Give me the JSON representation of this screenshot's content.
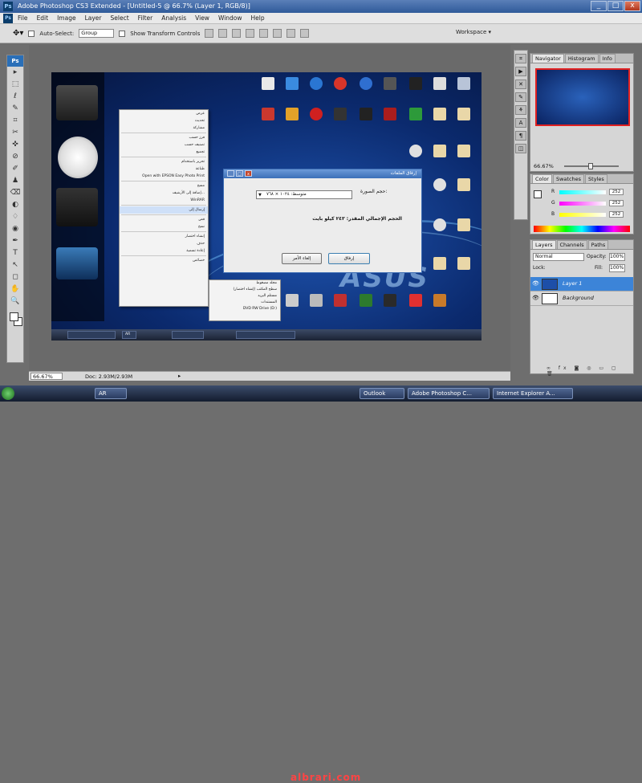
{
  "window": {
    "title": "Adobe Photoshop CS3 Extended - [Untitled-5 @ 66.7% (Layer 1, RGB/8)]",
    "app_badge": "Ps",
    "ctl_min": "_",
    "ctl_max": "□",
    "ctl_close": "x"
  },
  "menu": [
    "File",
    "Edit",
    "Image",
    "Layer",
    "Select",
    "Filter",
    "Analysis",
    "View",
    "Window",
    "Help"
  ],
  "options": {
    "tool_icon": "move-tool-icon",
    "auto_select_label": "Auto-Select:",
    "auto_select_value": "Group",
    "show_transform_label": "Show Transform Controls",
    "workspace_label": "Workspace ▾"
  },
  "toolbox": {
    "logo": "Ps",
    "tools": [
      "▸",
      "⬚",
      "ℓ",
      "✎",
      "⌗",
      "✂",
      "✜",
      "⊘",
      "✐",
      "♟",
      "⌫",
      "◐",
      "♢",
      "◉",
      "✒",
      "T",
      "↖",
      "◻",
      "✋",
      "🔍"
    ]
  },
  "canvas": {
    "brand": "ASUS",
    "ctx_menu": [
      "عرض",
      "تحديث",
      "مشاركة",
      "فرز حسب",
      "تصنيف حسب",
      "تجميع",
      "تحرير باستخدام",
      "طباعة",
      "Open with EPSON Easy Photo Print",
      "مسح",
      "إضافة إلى الأرشيف...",
      "WinRAR",
      "إرسال إلى",
      "قص",
      "نسخ",
      "إنشاء اختصار",
      "حذف",
      "إعادة تسمية",
      "خصائص"
    ],
    "submenu": [
      "مجلد مضغوط",
      "سطح المكتب (إنشاء اختصار)",
      "مستلم البريد",
      "المستندات",
      "DVD RW Drive (D:)"
    ],
    "taskbar_items": [
      "",
      "",
      "AR"
    ]
  },
  "dialog": {
    "title": "إرفاق الملفات",
    "image_size_label": "حجم الصورة:",
    "image_size_value": "متوسط: ١٠٢٤ × ٧٦٨",
    "total_size": "الحجم الإجمالي المقدر: ٢٤٣ كيلو بايت",
    "attach_button": "إرفاق",
    "cancel_button": "إلغاء الأمر"
  },
  "status": {
    "zoom": "66.67%",
    "doc": "Doc: 2.93M/2.93M",
    "arrow": "▸"
  },
  "navigator": {
    "tabs": [
      "Navigator",
      "Histogram",
      "Info"
    ],
    "zoom": "66.67%",
    "zoom_level": 0.45
  },
  "color": {
    "tabs": [
      "Color",
      "Swatches",
      "Styles"
    ],
    "channels": [
      {
        "label": "R",
        "value": "252"
      },
      {
        "label": "G",
        "value": "252"
      },
      {
        "label": "B",
        "value": "252"
      }
    ]
  },
  "layers": {
    "tabs": [
      "Layers",
      "Channels",
      "Paths"
    ],
    "mode": "Normal",
    "opacity_label": "Opacity:",
    "opacity": "100%",
    "lock_label": "Lock:",
    "fill_label": "Fill:",
    "fill": "100%",
    "items": [
      {
        "name": "Layer 1",
        "selected": true
      },
      {
        "name": "Background",
        "selected": false
      }
    ],
    "footer": "∞ fx ◙ ◎ ▭ ▢ 🗑"
  },
  "taskbar": {
    "items": [
      "AR",
      "Outlook",
      "Adobe Photoshop C...",
      "Internet Explorer A..."
    ],
    "watermark": "albrari.com",
    "clock": "▴"
  }
}
